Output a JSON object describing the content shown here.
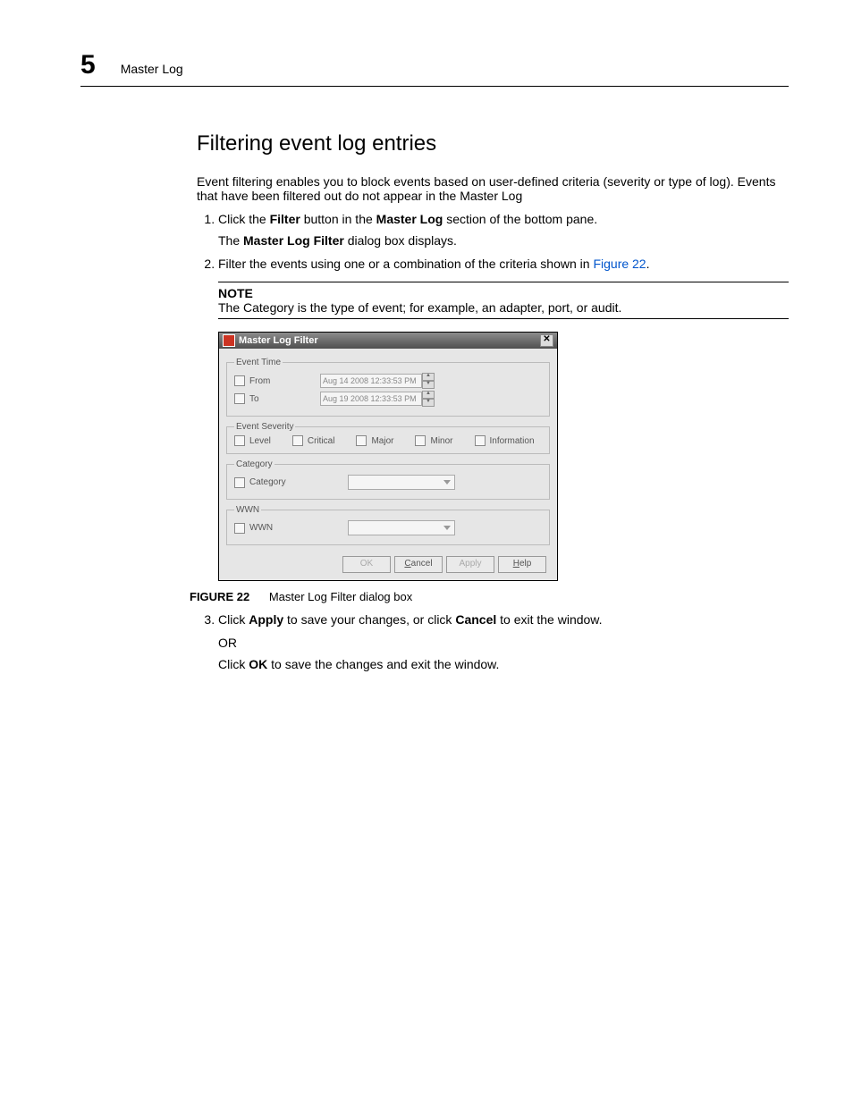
{
  "header": {
    "chapter_number": "5",
    "running_title": "Master Log"
  },
  "section_title": "Filtering event log entries",
  "intro": "Event filtering enables you to block events based on user-defined criteria (severity or type of log). Events that have been filtered out do not appear in the Master Log",
  "step1_pre": "Click the ",
  "step1_bold1": "Filter",
  "step1_mid": " button in the ",
  "step1_bold2": "Master Log",
  "step1_post": " section of the bottom pane.",
  "step1_sub_pre": "The ",
  "step1_sub_bold": "Master Log Filter",
  "step1_sub_post": " dialog box displays.",
  "step2_pre": "Filter the events using one or a combination of the criteria shown in ",
  "step2_link": "Figure 22",
  "step2_post": ".",
  "note_label": "NOTE",
  "note_text": "The Category is the type of event; for example, an adapter, port, or audit.",
  "dialog": {
    "title": "Master Log Filter",
    "close": "✕",
    "groups": {
      "event_time": "Event Time",
      "event_severity": "Event Severity",
      "category": "Category",
      "wwn": "WWN"
    },
    "labels": {
      "from": "From",
      "to": "To",
      "level": "Level",
      "critical": "Critical",
      "major": "Major",
      "minor": "Minor",
      "information": "Information",
      "category": "Category",
      "wwn": "WWN"
    },
    "dates": {
      "from": "Aug 14 2008 12:33:53  PM",
      "to": "Aug 19 2008 12:33:53  PM"
    },
    "buttons": {
      "ok": "OK",
      "cancel": "Cancel",
      "apply": "Apply",
      "help": "Help"
    }
  },
  "figure": {
    "label": "FIGURE 22",
    "caption": "Master Log Filter dialog box"
  },
  "step3_pre": "Click ",
  "step3_bold1": "Apply",
  "step3_mid": " to save your changes, or click ",
  "step3_bold2": "Cancel",
  "step3_post": " to exit the window.",
  "step3_or": "OR",
  "step3b_pre": "Click ",
  "step3b_bold": "OK",
  "step3b_post": " to save the changes and exit the window."
}
